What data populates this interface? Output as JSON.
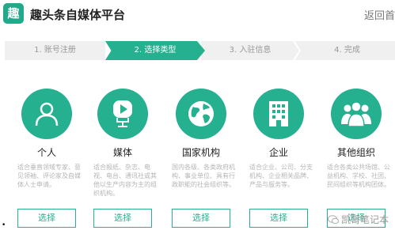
{
  "header": {
    "logo_char": "趣",
    "title": "趣头条自媒体平台",
    "return_label": "返回首"
  },
  "steps": [
    {
      "label": "1. 账号注册",
      "active": false
    },
    {
      "label": "2. 选择类型",
      "active": true
    },
    {
      "label": "3. 入驻信息",
      "active": false
    },
    {
      "label": "4. 完成",
      "active": false
    }
  ],
  "cards": [
    {
      "title": "个人",
      "icon": "person-icon",
      "desc": "适合垂直领域专家、意见领袖、评论家及自媒体人士申请。",
      "button": "选择"
    },
    {
      "title": "媒体",
      "icon": "microphone-icon",
      "desc": "适合报纸、杂志、电视、电台、通讯社或其他以生产内容为主的组织机构。",
      "button": "选择"
    },
    {
      "title": "国家机构",
      "icon": "globe-icon",
      "desc": "国内各级、各类政府机构、事业单位、具有行政职能的社会组织等。",
      "button": "选择"
    },
    {
      "title": "企业",
      "icon": "building-icon",
      "desc": "适合企业、公司、分支机构、企业相关品牌、产品与服务等。",
      "button": "选择"
    },
    {
      "title": "其他组织",
      "icon": "group-icon",
      "desc": "适合各类公共场馆、公益机构、学校、社团、民间组织等机构团体。",
      "button": "选择"
    }
  ],
  "watermark": "凯哥笔记本",
  "bullet": "•",
  "colors": {
    "accent": "#25b08f",
    "step_inactive": "#f0f0f0"
  }
}
